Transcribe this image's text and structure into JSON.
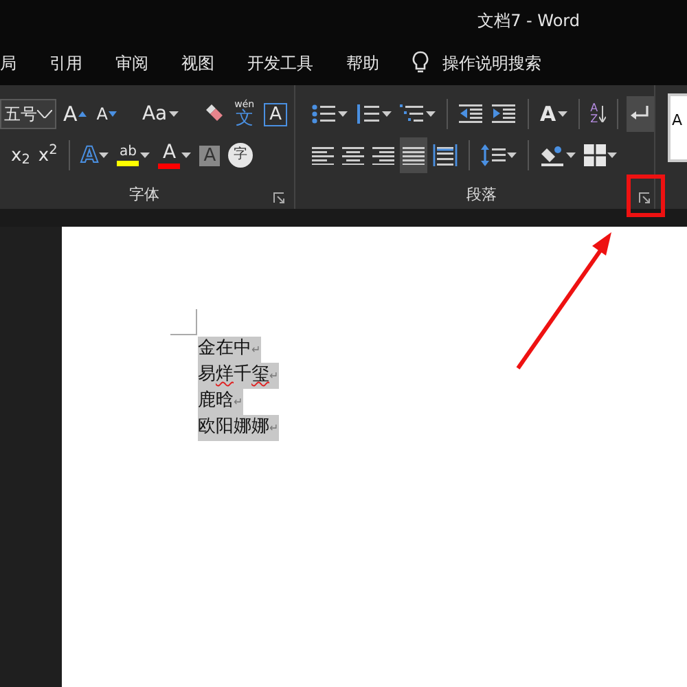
{
  "window": {
    "title": "文档7  -  Word"
  },
  "tabs": [
    {
      "label": "局",
      "selected": false
    },
    {
      "label": "引用",
      "selected": false
    },
    {
      "label": "审阅",
      "selected": false
    },
    {
      "label": "视图",
      "selected": false
    },
    {
      "label": "开发工具",
      "selected": false
    },
    {
      "label": "帮助",
      "selected": false
    }
  ],
  "tell_me": {
    "placeholder": "操作说明搜索"
  },
  "font_group": {
    "label": "字体",
    "font_size": "五号",
    "row_1": [
      {
        "kind": "grow",
        "text": "A",
        "dropdown": false
      },
      {
        "kind": "shrink",
        "text": "A",
        "dropdown": false
      },
      {
        "kind": "sep"
      },
      {
        "kind": "case",
        "text": "Aa",
        "dropdown": true
      },
      {
        "kind": "sep"
      },
      {
        "kind": "eraser",
        "dropdown": false
      },
      {
        "kind": "phonetic",
        "text": "文",
        "ruby": "wén",
        "dropdown": false
      },
      {
        "kind": "boxed",
        "text": "A",
        "dropdown": false
      }
    ],
    "row_2": [
      {
        "kind": "sub",
        "text": "x$_{2}$",
        "dropdown": false
      },
      {
        "kind": "sup",
        "text": "x$^{2}$",
        "dropdown": false
      },
      {
        "kind": "sep"
      },
      {
        "kind": "effect",
        "text": "A",
        "dropdown": true
      },
      {
        "kind": "highlight",
        "text": "ab",
        "color": "#ffff00",
        "dropdown": true
      },
      {
        "kind": "fontcolor",
        "text": "A",
        "color": "#ff0000",
        "dropdown": true
      },
      {
        "kind": "shaded",
        "text": "A",
        "dropdown": false
      },
      {
        "kind": "enclose",
        "text": "字",
        "dropdown": false
      }
    ]
  },
  "paragraph_group": {
    "label": "段落",
    "row_1": [
      {
        "kind": "bullets",
        "dropdown": true,
        "selected": false
      },
      {
        "kind": "numbering",
        "dropdown": true,
        "selected": false
      },
      {
        "kind": "multilevel",
        "dropdown": true,
        "selected": false
      },
      {
        "kind": "sep"
      },
      {
        "kind": "outdent",
        "dropdown": false,
        "selected": false
      },
      {
        "kind": "indent",
        "dropdown": false,
        "selected": false
      },
      {
        "kind": "sep"
      },
      {
        "kind": "asian",
        "text": "A",
        "dropdown": true,
        "selected": false
      },
      {
        "kind": "sep"
      },
      {
        "kind": "sort",
        "text": "AZ",
        "dropdown": false,
        "selected": false
      },
      {
        "kind": "sep"
      },
      {
        "kind": "marks",
        "dropdown": false,
        "selected": true
      }
    ],
    "row_2": [
      {
        "kind": "left",
        "dropdown": false,
        "selected": false
      },
      {
        "kind": "center",
        "dropdown": false,
        "selected": false
      },
      {
        "kind": "right",
        "dropdown": false,
        "selected": false
      },
      {
        "kind": "justify",
        "dropdown": false,
        "selected": true
      },
      {
        "kind": "distribute",
        "dropdown": false,
        "selected": false
      },
      {
        "kind": "sep"
      },
      {
        "kind": "spacing",
        "dropdown": true,
        "selected": false
      },
      {
        "kind": "sep"
      },
      {
        "kind": "shading",
        "dropdown": true,
        "selected": false
      },
      {
        "kind": "borders",
        "dropdown": true,
        "selected": false
      }
    ]
  },
  "styles_gallery": {
    "text": "A"
  },
  "document": {
    "lines": [
      {
        "segments": [
          {
            "text": "金在中",
            "flagged": false
          }
        ],
        "end_mark": "↵",
        "selected": true
      },
      {
        "segments": [
          {
            "text": "易",
            "flagged": false
          },
          {
            "text": "烊",
            "flagged": true
          },
          {
            "text": "千",
            "flagged": false
          },
          {
            "text": "玺",
            "flagged": true
          }
        ],
        "end_mark": "↵",
        "selected": true
      },
      {
        "segments": [
          {
            "text": "鹿晗",
            "flagged": false
          }
        ],
        "end_mark": "↵",
        "selected": true
      },
      {
        "segments": [
          {
            "text": "欧阳娜娜",
            "flagged": false
          }
        ],
        "end_mark": "↵",
        "selected": true
      }
    ]
  },
  "annotations": {
    "highlight_box": {
      "color": "#ee1111"
    },
    "arrow": {
      "color": "#ee1111"
    }
  }
}
